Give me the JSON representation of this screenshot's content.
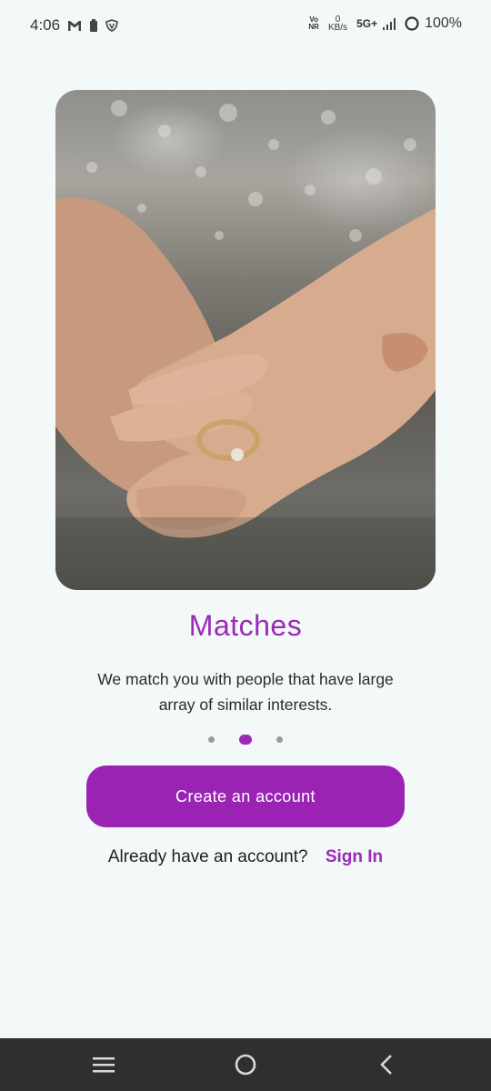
{
  "status_bar": {
    "time": "4:06",
    "left_icons": [
      "gmail-icon",
      "battery-saver-icon",
      "vpn-shield-icon"
    ],
    "volte_top": "Vo",
    "volte_bottom": "NR",
    "net_speed_value": "0",
    "net_speed_unit": "KB/s",
    "network": "5G+",
    "battery": "100%"
  },
  "onboarding": {
    "hero_image": "hands-with-ring-photo",
    "title": "Matches",
    "description": "We match you with people that have large array of similar interests.",
    "pager": {
      "count": 3,
      "active_index": 1
    }
  },
  "actions": {
    "create_account_label": "Create an account",
    "signin_prompt": "Already have an account?",
    "signin_link": "Sign In"
  },
  "colors": {
    "accent": "#9b23b4",
    "background": "#f3f9f9",
    "nav_bar": "#2f2f2f"
  },
  "nav_bar": {
    "buttons": [
      "menu-icon",
      "home-icon",
      "back-icon"
    ]
  }
}
